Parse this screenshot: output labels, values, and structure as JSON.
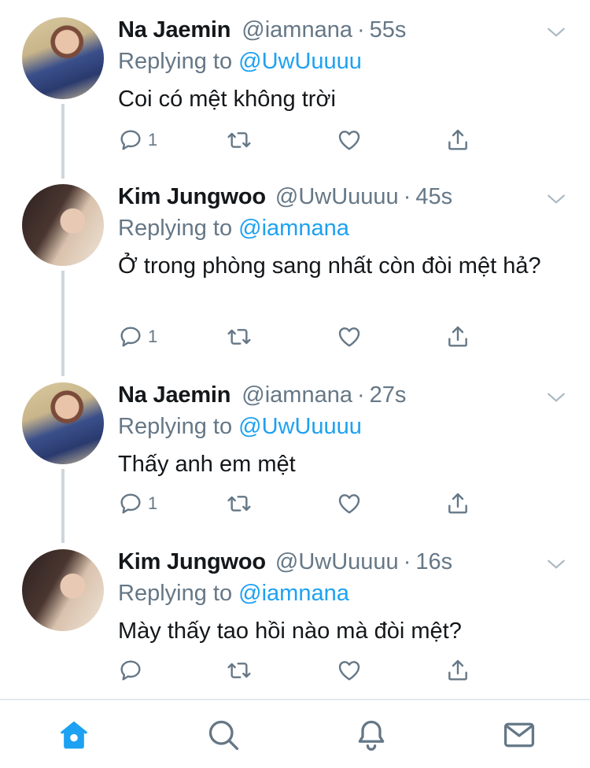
{
  "tweets": [
    {
      "name": "Na Jaemin",
      "handle": "@iamnana",
      "time": "55s",
      "replying_prefix": "Replying to",
      "replying_to": "@UwUuuuu",
      "text": "Coi có mệt không trời",
      "reply_count": "1",
      "avatar_icon": "avatar-na-jaemin"
    },
    {
      "name": "Kim Jungwoo",
      "handle": "@UwUuuuu",
      "time": "45s",
      "replying_prefix": "Replying to",
      "replying_to": "@iamnana",
      "text": "Ở trong phòng sang nhất còn đòi mệt hả?",
      "reply_count": "1",
      "avatar_icon": "avatar-kim-jungwoo"
    },
    {
      "name": "Na Jaemin",
      "handle": "@iamnana",
      "time": "27s",
      "replying_prefix": "Replying to",
      "replying_to": "@UwUuuuu",
      "text": "Thấy anh em mệt",
      "reply_count": "1",
      "avatar_icon": "avatar-na-jaemin"
    },
    {
      "name": "Kim Jungwoo",
      "handle": "@UwUuuuu",
      "time": "16s",
      "replying_prefix": "Replying to",
      "replying_to": "@iamnana",
      "text": "Mày thấy tao hồi nào mà đòi mệt?",
      "reply_count": "",
      "avatar_icon": "avatar-kim-jungwoo"
    }
  ],
  "separator": "·",
  "tabbar": {
    "items": [
      "home-icon",
      "search-icon",
      "bell-icon",
      "mail-icon"
    ],
    "active": "home-icon"
  },
  "colors": {
    "link": "#1da1f2",
    "muted": "#657786",
    "text": "#14171a",
    "thread_line": "#ccd6dd",
    "active_tab": "#1da1f2"
  }
}
